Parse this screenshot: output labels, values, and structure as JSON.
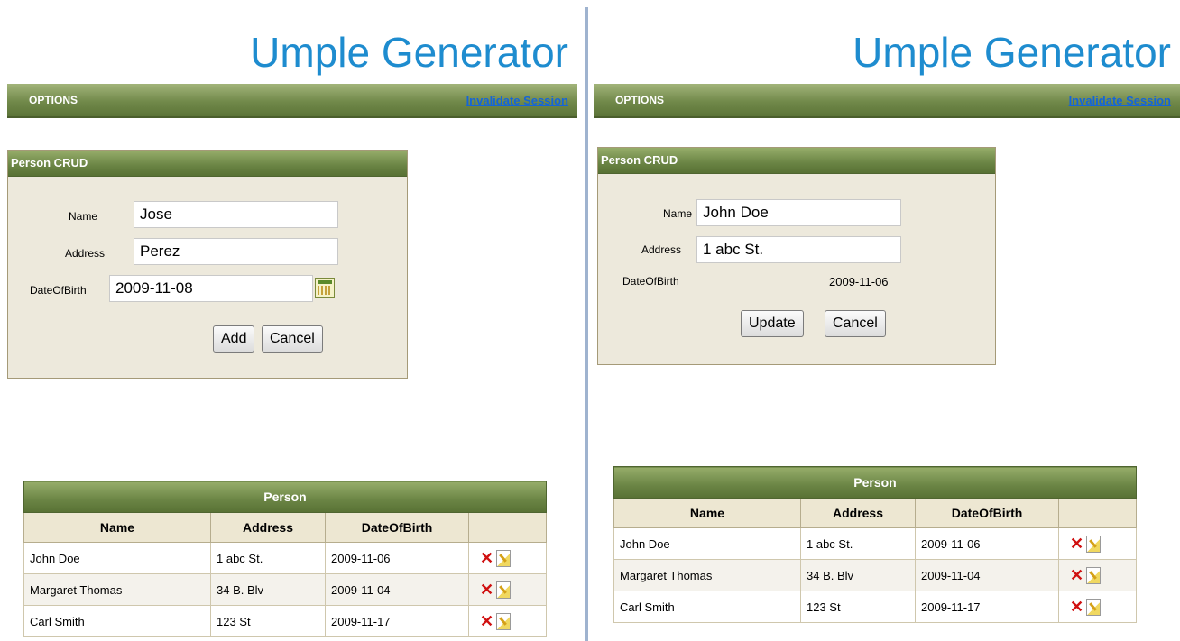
{
  "left": {
    "title": "Umple Generator",
    "options_label": "OPTIONS",
    "invalidate_link": "Invalidate Session",
    "crud": {
      "header": "Person CRUD",
      "name_label": "Name",
      "name_value": "Jose",
      "address_label": "Address",
      "address_value": "Perez",
      "dob_label": "DateOfBirth",
      "dob_value": "2009-11-08",
      "add_label": "Add",
      "cancel_label": "Cancel"
    },
    "table": {
      "caption": "Person",
      "headers": [
        "Name",
        "Address",
        "DateOfBirth"
      ],
      "rows": [
        [
          "John Doe",
          "1 abc St.",
          "2009-11-06"
        ],
        [
          "Margaret Thomas",
          "34 B. Blv",
          "2009-11-04"
        ],
        [
          "Carl Smith",
          "123 St",
          "2009-11-17"
        ]
      ]
    }
  },
  "right": {
    "title": "Umple Generator",
    "options_label": "OPTIONS",
    "invalidate_link": "Invalidate Session",
    "crud": {
      "header": "Person CRUD",
      "name_label": "Name",
      "name_value": "John Doe",
      "address_label": "Address",
      "address_value": "1 abc St.",
      "dob_label": "DateOfBirth",
      "dob_value": "2009-11-06",
      "update_label": "Update",
      "cancel_label": "Cancel"
    },
    "table": {
      "caption": "Person",
      "headers": [
        "Name",
        "Address",
        "DateOfBirth"
      ],
      "rows": [
        [
          "John Doe",
          "1 abc St.",
          "2009-11-06"
        ],
        [
          "Margaret Thomas",
          "34 B. Blv",
          "2009-11-04"
        ],
        [
          "Carl Smith",
          "123 St",
          "2009-11-17"
        ]
      ]
    }
  },
  "icons": {
    "delete": "delete-x-icon",
    "edit": "edit-pencil-icon",
    "calendar": "calendar-icon"
  },
  "colors": {
    "title": "#1e8ccf",
    "header_green": "#6a8444",
    "panel_bg": "#ede9dc",
    "link": "#1565d8"
  }
}
